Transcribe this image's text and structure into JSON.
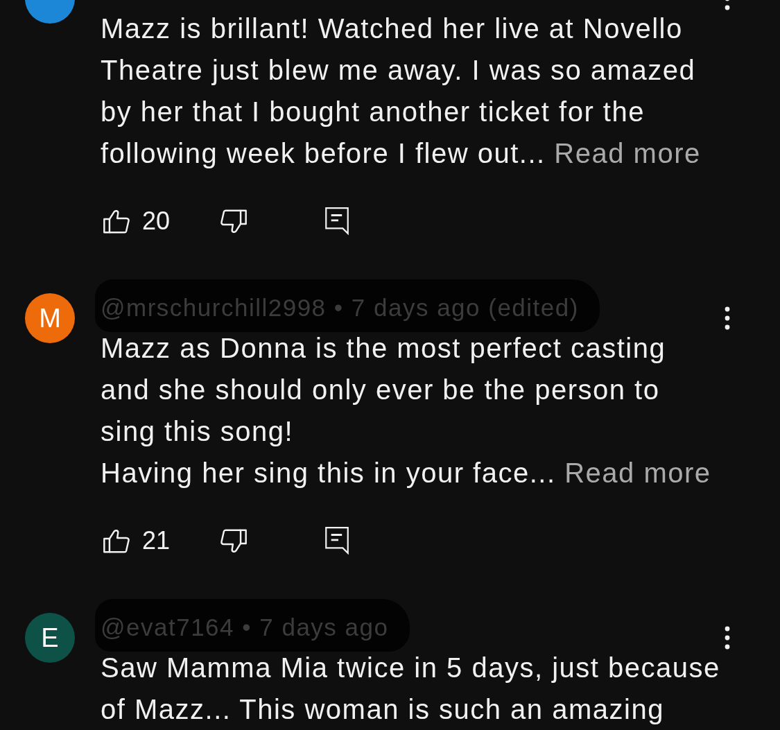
{
  "comments": [
    {
      "avatar": {
        "color": "#1c87d6"
      },
      "text": "Mazz is brillant! Watched her live at Novello Theatre just blew me away. I was so amazed by her that I bought another ticket for the following week before I flew out...",
      "read_more": "Read more",
      "actions": {
        "likes": "20"
      }
    },
    {
      "avatar": {
        "letter": "M",
        "color": "#ee6b0c"
      },
      "header": {
        "text": "@mrschurchill2998 • 7 days ago (edited)",
        "redacted": true
      },
      "text": "Mazz as Donna is the most perfect casting and she should only ever be the person to sing this song!\nHaving her sing this in your face...",
      "read_more": "Read more",
      "actions": {
        "likes": "21"
      }
    },
    {
      "avatar": {
        "letter": "E",
        "color": "#0e5247"
      },
      "header": {
        "text": "@evat7164 • 7 days ago",
        "redacted": true
      },
      "text": "Saw Mamma Mia twice in 5 days, just because of Mazz... This woman is such an amazing"
    }
  ]
}
